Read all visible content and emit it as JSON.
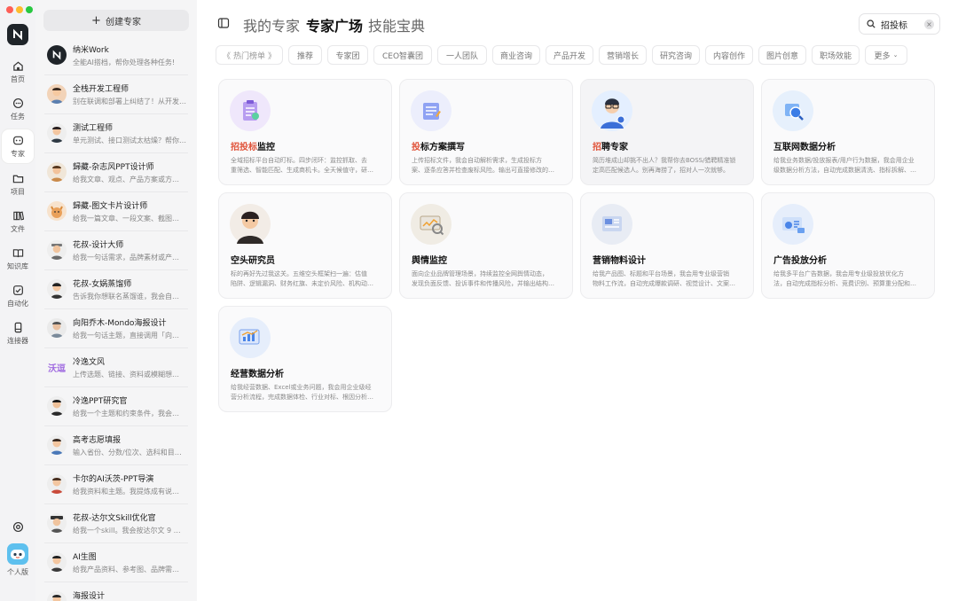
{
  "window": {
    "traffic_lights": [
      "#fe5f57",
      "#febc2e",
      "#28c840"
    ]
  },
  "rail": {
    "items": [
      {
        "label": "首页",
        "icon": "home-icon"
      },
      {
        "label": "任务",
        "icon": "chat-icon"
      },
      {
        "label": "专家",
        "icon": "expert-icon",
        "active": true
      },
      {
        "label": "项目",
        "icon": "folder-icon"
      },
      {
        "label": "文件",
        "icon": "files-icon"
      },
      {
        "label": "知识库",
        "icon": "book-icon"
      },
      {
        "label": "自动化",
        "icon": "check-box-icon"
      },
      {
        "label": "连接器",
        "icon": "device-icon"
      }
    ],
    "bottom_settings_icon": "settings-icon",
    "user_label": "个人版"
  },
  "expert_list": {
    "create_label": "创建专家",
    "items": [
      {
        "name": "纳米Work",
        "desc": "全能AI搭档，帮你处理各种任务!"
      },
      {
        "name": "全栈开发工程师",
        "desc": "别在联调和部署上纠结了！从开发到上线…"
      },
      {
        "name": "测试工程师",
        "desc": "单元测试、接口测试太枯燥？帮你搞定…"
      },
      {
        "name": "歸藏-杂志风PPT设计师",
        "desc": "给我文章、观点、产品方案或方…"
      },
      {
        "name": "歸藏-图文卡片设计师",
        "desc": "给我一篇文章、一段文案、截图…"
      },
      {
        "name": "花叔-设计大师",
        "desc": "给我一句话需求，品牌素材或产…"
      },
      {
        "name": "花叔-女娲蒸馏师",
        "desc": "告诉我你想联名蒸馏谁，我会自…"
      },
      {
        "name": "向阳乔木-Mondo海报设计",
        "desc": "给我一句话主题，直接调用「向…"
      },
      {
        "name": "冷逸文风",
        "desc": "上传选题、链接、资料或模糊想…",
        "avatar_text": "沃逗"
      },
      {
        "name": "冷逸PPT研究官",
        "desc": "给我一个主题和约束条件，我会…"
      },
      {
        "name": "高考志愿填报",
        "desc": "输入省份、分数/位次、选科和目…"
      },
      {
        "name": "卡尔的AI沃茨-PPT导演",
        "desc": "给我资料和主题。我提炼成有说…"
      },
      {
        "name": "花叔-达尔文Skill优化官",
        "desc": "给我一个skill。我会按达尔文 9 维…"
      },
      {
        "name": "AI生图",
        "desc": "给我产品资料、参考图、品牌需…"
      },
      {
        "name": "海报设计",
        "desc": ""
      }
    ]
  },
  "header": {
    "tabs": [
      {
        "label": "我的专家",
        "active": false
      },
      {
        "label": "专家广场",
        "active": true
      },
      {
        "label": "技能宝典",
        "active": false
      }
    ],
    "search": {
      "value": "招投标",
      "clear": "×"
    }
  },
  "chips": [
    "热门榜单",
    "推荐",
    "专家团",
    "CEO智囊团",
    "一人团队",
    "商业咨询",
    "产品开发",
    "营销增长",
    "研究咨询",
    "内容创作",
    "图片创意",
    "职场效能",
    "更多"
  ],
  "cards": [
    {
      "title_hl": "招投标",
      "title_rest": "监控",
      "desc": [
        "全域招标平台自动盯标。四步闭环：监控抓取、去",
        "重筛选、智能匹配、生成商机卡。全天候值守，研…"
      ],
      "icon": "clipboard-icon"
    },
    {
      "title_hl": "投",
      "title_mid": "标方案撰写",
      "desc": [
        "上传招标文件，我会自动解析需求，生成投标方",
        "案、逐条应答并检查废标风险。输出可直接修改的…"
      ],
      "icon": "document-icon"
    },
    {
      "title_hl": "招",
      "title_rest": "聘专家",
      "desc": [
        "简历堆成山却挑不出人？我帮你去BOSS/猎聘精准锁",
        "定高匹配候选人。别再海捞了，招对人一次就够。"
      ],
      "icon": "recruiter-avatar-icon"
    },
    {
      "title_rest": "互联网数据分析",
      "desc": [
        "给我业务数据/投放报表/用户行为数据，我会用企业",
        "级数据分析方法，自动完成数据清洗、指标拆解、…"
      ],
      "icon": "data-magnifier-icon"
    },
    {
      "title_rest": "空头研究员",
      "desc": [
        "标的再好先过我这关。五维空头框架扫一遍：估值",
        "陷阱、逻辑漏洞、财务红旗、未定价风险、机构动…"
      ],
      "icon": "researcher-avatar-icon"
    },
    {
      "title_rest": "舆情监控",
      "desc": [
        "面向企业品牌管理场景，持续监控全网舆情动态，",
        "发现负面反馈、投诉事件和传播风险，并输出结构…"
      ],
      "icon": "monitor-icon"
    },
    {
      "title_rest": "营销物料设计",
      "desc": [
        "给我产品图、标题和平台场景，我会用专业级营销",
        "物料工作流，自动完成爆款调研、视觉设计、文案…"
      ],
      "icon": "design-board-icon"
    },
    {
      "title_rest": "广告投放分析",
      "desc": [
        "给我多平台广告数据，我会用专业级投放优化方",
        "法，自动完成指标分析、竞费识别、预算重分配和…"
      ],
      "icon": "ad-analytics-icon"
    },
    {
      "title_rest": "经营数据分析",
      "desc": [
        "给我经营数据、Excel或业务问题，我会用企业级经",
        "营分析流程，完成数据体检、行业对标、根因分析…"
      ],
      "icon": "chart-board-icon"
    }
  ]
}
